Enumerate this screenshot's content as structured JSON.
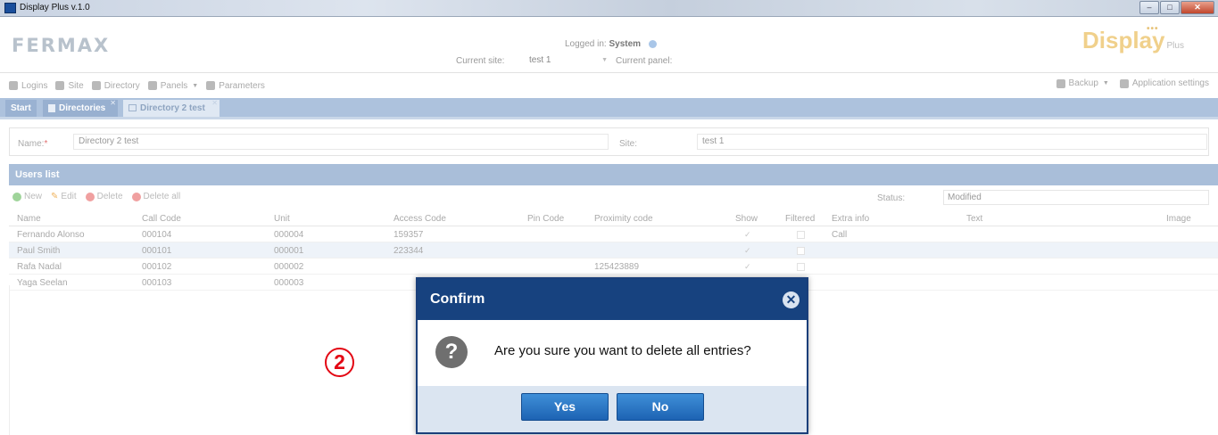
{
  "window": {
    "title": "Display Plus v.1.0"
  },
  "header": {
    "logo_text": "FERMAX",
    "logged_in_label": "Logged in:",
    "logged_in_user": "System",
    "current_site_label": "Current site:",
    "current_site_value": "test 1",
    "current_panel_label": "Current panel:",
    "display_logo_text": "Display",
    "display_logo_plus": "Plus"
  },
  "toolbar": {
    "items": [
      "Logins",
      "Site",
      "Directory",
      "Panels",
      "Parameters"
    ],
    "right_items": [
      "Backup",
      "Application settings"
    ]
  },
  "tabs": [
    {
      "label": "Start"
    },
    {
      "label": "Directories"
    },
    {
      "label": "Directory 2 test"
    }
  ],
  "form": {
    "name_label": "Name:",
    "required_mark": "*",
    "name_value": "Directory 2 test",
    "site_label": "Site:",
    "site_value": "test 1"
  },
  "users": {
    "title": "Users list",
    "buttons": [
      "New",
      "Edit",
      "Delete",
      "Delete all"
    ],
    "status_label": "Status:",
    "status_value": "Modified",
    "columns": [
      "Name",
      "Call Code",
      "Unit",
      "Access Code",
      "Pin Code",
      "Proximity code",
      "Show",
      "Filtered",
      "Extra info",
      "Text",
      "Image"
    ],
    "rows": [
      {
        "name": "Fernando Alonso",
        "call_code": "000104",
        "unit": "000004",
        "access_code": "159357",
        "pin_code": "",
        "proximity": "",
        "extra": "Call"
      },
      {
        "name": "Paul Smith",
        "call_code": "000101",
        "unit": "000001",
        "access_code": "223344",
        "pin_code": "",
        "proximity": "",
        "extra": ""
      },
      {
        "name": "Rafa Nadal",
        "call_code": "000102",
        "unit": "000002",
        "access_code": "",
        "pin_code": "",
        "proximity": "125423889",
        "extra": ""
      },
      {
        "name": "Yaga Seelan",
        "call_code": "000103",
        "unit": "000003",
        "access_code": "",
        "pin_code": "",
        "proximity": "",
        "extra": ""
      }
    ]
  },
  "annotation": {
    "step": "2"
  },
  "dialog": {
    "title": "Confirm",
    "message": "Are you sure you want to delete all entries?",
    "yes_label": "Yes",
    "no_label": "No"
  },
  "colors": {
    "accent": "#17427f",
    "tab_bar": "#adc2dd",
    "annotation": "#e30613"
  }
}
